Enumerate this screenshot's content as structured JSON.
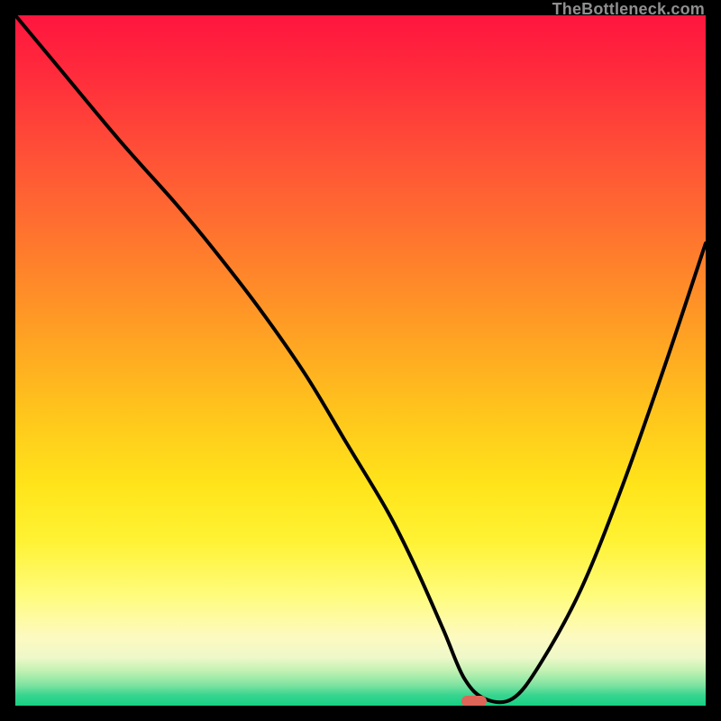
{
  "watermark": "TheBottleneck.com",
  "marker": {
    "x_pct": 66.5,
    "y_pct": 99.4
  },
  "chart_data": {
    "type": "line",
    "title": "",
    "xlabel": "",
    "ylabel": "",
    "xlim": [
      0,
      100
    ],
    "ylim": [
      0,
      100
    ],
    "series": [
      {
        "name": "bottleneck-curve",
        "x": [
          0,
          5,
          15,
          23,
          28,
          35,
          42,
          48,
          54,
          58,
          62,
          65,
          68,
          72,
          76,
          82,
          88,
          94,
          100
        ],
        "y": [
          100,
          94,
          82,
          73,
          67,
          58,
          48,
          38,
          28,
          20,
          11,
          4,
          1,
          1,
          6,
          17,
          32,
          49,
          67
        ]
      }
    ],
    "annotations": [],
    "legend": null
  },
  "colors": {
    "curve_stroke": "#000000",
    "marker_fill": "#df6558",
    "background": "#000000"
  }
}
